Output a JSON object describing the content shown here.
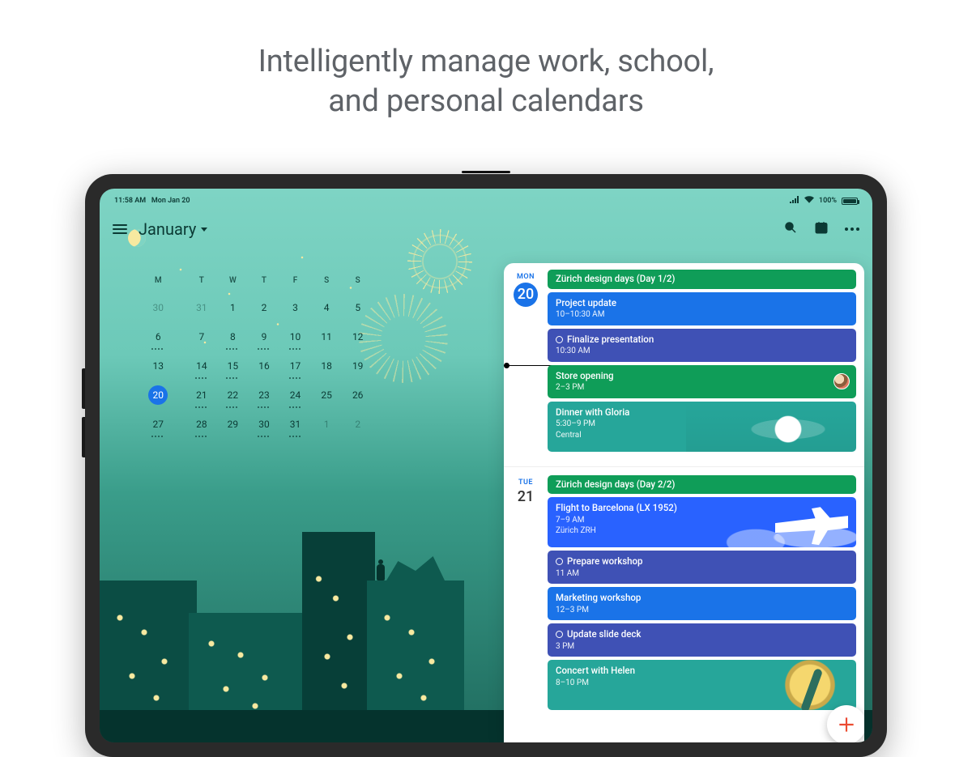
{
  "headline": {
    "line1": "Intelligently manage work, school,",
    "line2": "and personal calendars"
  },
  "status_bar": {
    "time": "11:58 AM",
    "date": "Mon Jan 20",
    "battery": "100%"
  },
  "app_bar": {
    "month": "January"
  },
  "mini_calendar": {
    "weekdays": [
      "M",
      "T",
      "W",
      "T",
      "F",
      "S",
      "S"
    ],
    "rows": [
      [
        {
          "n": "30",
          "dim": true
        },
        {
          "n": "31",
          "dim": true
        },
        {
          "n": "1"
        },
        {
          "n": "2"
        },
        {
          "n": "3"
        },
        {
          "n": "4"
        },
        {
          "n": "5"
        }
      ],
      [
        {
          "n": "6",
          "dots": true
        },
        {
          "n": "7"
        },
        {
          "n": "8",
          "dots": true
        },
        {
          "n": "9",
          "dots": true
        },
        {
          "n": "10",
          "dots": true
        },
        {
          "n": "11"
        },
        {
          "n": "12"
        }
      ],
      [
        {
          "n": "13"
        },
        {
          "n": "14",
          "dots": true
        },
        {
          "n": "15",
          "dots": true
        },
        {
          "n": "16"
        },
        {
          "n": "17",
          "dots": true
        },
        {
          "n": "18"
        },
        {
          "n": "19"
        }
      ],
      [
        {
          "n": "20",
          "selected": true
        },
        {
          "n": "21",
          "dots": true
        },
        {
          "n": "22",
          "dots": true
        },
        {
          "n": "23",
          "dots": true
        },
        {
          "n": "24",
          "dots": true
        },
        {
          "n": "25"
        },
        {
          "n": "26"
        }
      ],
      [
        {
          "n": "27",
          "dots": true
        },
        {
          "n": "28",
          "dots": true
        },
        {
          "n": "29"
        },
        {
          "n": "30",
          "dots": true
        },
        {
          "n": "31",
          "dots": true
        },
        {
          "n": "1",
          "dim": true
        },
        {
          "n": "2",
          "dim": true
        }
      ]
    ]
  },
  "colors": {
    "green": "#0f9d58",
    "blue": "#1a73e8",
    "indigo": "#3f51b5",
    "teal": "#26a69a",
    "flight": "#2962ff"
  },
  "schedule": [
    {
      "dow": "MON",
      "dnum": "20",
      "active": true,
      "events": [
        {
          "color": "green",
          "size": "small",
          "title": "Zürich design days (Day 1/2)"
        },
        {
          "color": "blue",
          "title": "Project update",
          "time": "10–10:30 AM"
        },
        {
          "color": "indigo",
          "ring": true,
          "title": "Finalize presentation",
          "time": "10:30 AM",
          "now_after": true
        },
        {
          "color": "green",
          "title": "Store opening",
          "time": "2–3 PM",
          "avatar": true
        },
        {
          "color": "teal",
          "art": "dinner",
          "tall": true,
          "title": "Dinner with Gloria",
          "time": "5:30–9 PM",
          "place": "Central"
        }
      ]
    },
    {
      "dow": "TUE",
      "dnum": "21",
      "active": false,
      "events": [
        {
          "color": "green",
          "size": "small",
          "title": "Zürich design days (Day 2/2)"
        },
        {
          "color": "flight",
          "art": "flight",
          "tall": true,
          "title": "Flight to Barcelona (LX 1952)",
          "time": "7–9 AM",
          "place": "Zürich ZRH"
        },
        {
          "color": "indigo",
          "ring": true,
          "title": "Prepare workshop",
          "time": "11 AM"
        },
        {
          "color": "blue",
          "title": "Marketing workshop",
          "time": "12–3 PM"
        },
        {
          "color": "indigo",
          "ring": true,
          "title": "Update slide deck",
          "time": "3 PM"
        },
        {
          "color": "teal",
          "art": "concert",
          "tall": true,
          "title": "Concert with Helen",
          "time": "8–10 PM"
        }
      ]
    }
  ]
}
